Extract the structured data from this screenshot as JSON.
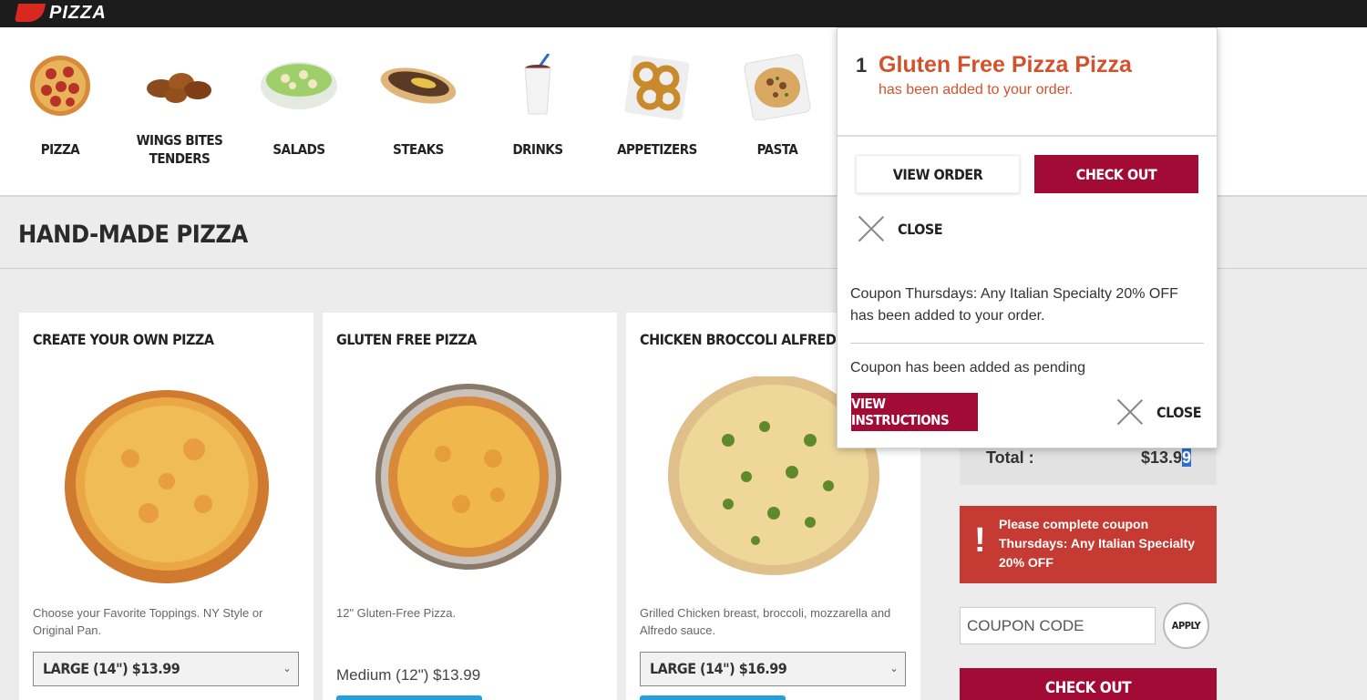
{
  "logo": {
    "text": "PIZZA"
  },
  "categories": [
    {
      "label": "PIZZA",
      "icon": "pizza-icon"
    },
    {
      "label": "WINGS BITES TENDERS",
      "icon": "wings-icon"
    },
    {
      "label": "SALADS",
      "icon": "salad-icon"
    },
    {
      "label": "STEAKS",
      "icon": "steak-sandwich-icon"
    },
    {
      "label": "DRINKS",
      "icon": "drink-cup-icon"
    },
    {
      "label": "APPETIZERS",
      "icon": "onion-rings-icon"
    },
    {
      "label": "PASTA",
      "icon": "pasta-icon"
    }
  ],
  "page_title": "HAND-MADE PIZZA",
  "products": [
    {
      "title": "CREATE YOUR OWN PIZZA",
      "description": "Choose your Favorite Toppings. NY Style or Original Pan.",
      "size_option": "LARGE (14\")  $13.99"
    },
    {
      "title": "GLUTEN FREE PIZZA",
      "description": "12\" Gluten-Free Pizza.",
      "price_text": "Medium (12\") $13.99"
    },
    {
      "title": "CHICKEN BROCCOLI ALFREDO",
      "description": "Grilled Chicken breast, broccoli, mozzarella and Alfredo sauce.",
      "size_option": "LARGE (14\")  $16.99"
    }
  ],
  "order": {
    "total_label": "Total :",
    "total_value_main": "$13.9",
    "total_value_highlight": "9",
    "alert_icon": "!",
    "alert_text": "Please complete coupon Thursdays: Any Italian Specialty 20% OFF",
    "coupon_placeholder": "COUPON CODE",
    "apply_label": "APPLY",
    "checkout_label": "CHECK OUT"
  },
  "popup": {
    "quantity": "1",
    "product_name": "Gluten Free Pizza Pizza",
    "added_text": "has been added to your order.",
    "view_order_label": "VIEW ORDER",
    "checkout_label": "CHECK OUT",
    "close_label": "CLOSE",
    "coupon_message": "Coupon Thursdays: Any Italian Specialty 20% OFF has been added to your order.",
    "pending_text": "Coupon has been added as pending",
    "view_instructions_label": "VIEW INSTRUCTIONS",
    "close2_label": "CLOSE"
  },
  "colors": {
    "brand_red": "#a30b37",
    "alert_red": "#c53a32",
    "accent_orange": "#d4522b",
    "topbar": "#1c1c1c",
    "select_blue": "#2f6fd0"
  }
}
